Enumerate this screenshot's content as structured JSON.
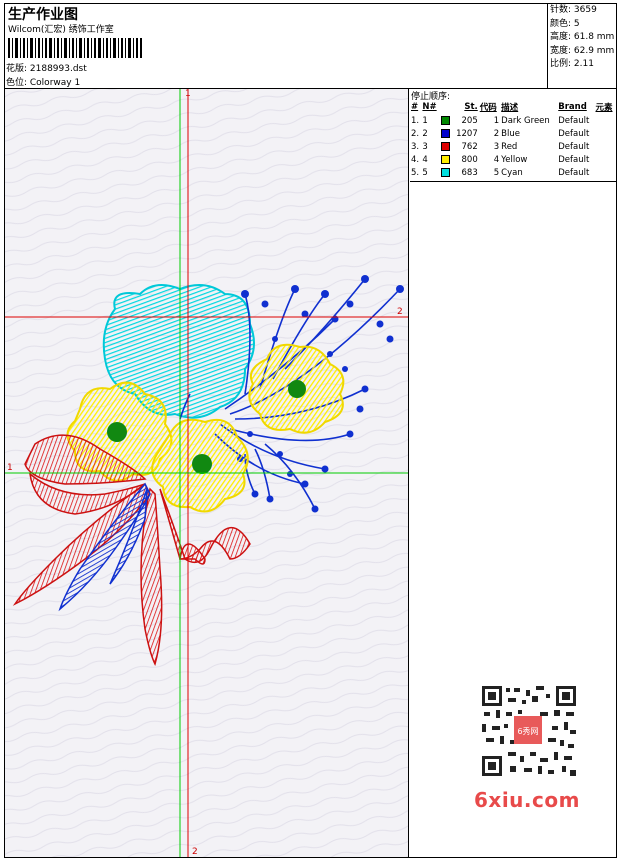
{
  "header": {
    "title": "生产作业图",
    "company": "Wilcom(汇宏) 绣饰工作室",
    "pattern_label": "花版: 2188993.dst",
    "colorway_label": "色位: Colorway 1"
  },
  "stats": {
    "stitches": "针数: 3659",
    "colors": "颜色: 5",
    "height": "高度: 61.8 mm",
    "width": "宽度: 62.9 mm",
    "ratio": "比例: 2.11"
  },
  "sequence": {
    "title": "停止顺序:",
    "headers": [
      "#",
      "N#",
      "",
      "St.",
      "代码",
      "描述",
      "Brand",
      "元素"
    ],
    "rows": [
      {
        "idx": "1.",
        "n": "1",
        "color": "#008800",
        "st": "205",
        "code": "1",
        "desc": "Dark Green",
        "brand": "Default"
      },
      {
        "idx": "2.",
        "n": "2",
        "color": "#0000cc",
        "st": "1207",
        "code": "2",
        "desc": "Blue",
        "brand": "Default"
      },
      {
        "idx": "3.",
        "n": "3",
        "color": "#dd0000",
        "st": "762",
        "code": "3",
        "desc": "Red",
        "brand": "Default"
      },
      {
        "idx": "4.",
        "n": "4",
        "color": "#ffee00",
        "st": "800",
        "code": "4",
        "desc": "Yellow",
        "brand": "Default"
      },
      {
        "idx": "5.",
        "n": "5",
        "color": "#00e0e0",
        "st": "683",
        "code": "5",
        "desc": "Cyan",
        "brand": "Default"
      }
    ]
  },
  "canvas": {
    "axis_top": "1",
    "axis_left": "1",
    "axis_bottom": "2",
    "axis_right": "2"
  },
  "watermark": {
    "site": "6xiu.com",
    "qr_badge": "6秀网"
  }
}
